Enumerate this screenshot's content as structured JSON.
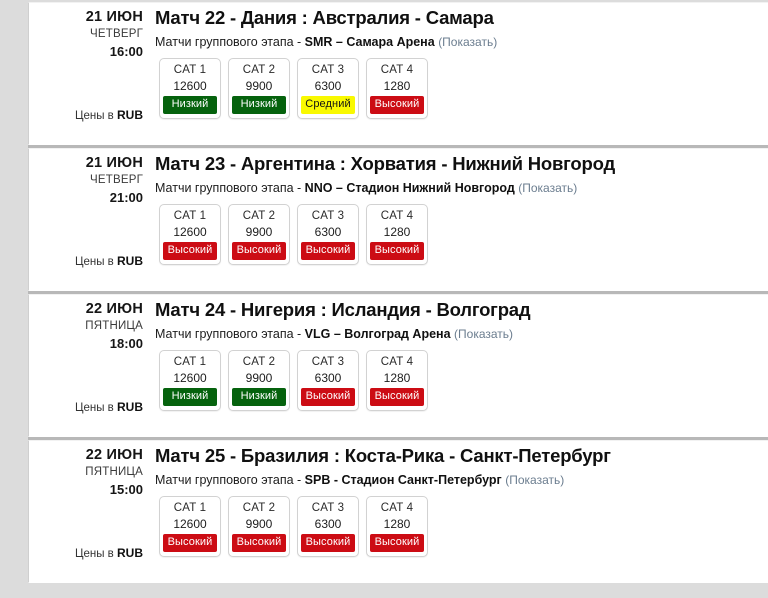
{
  "currency_note_prefix": "Цены в ",
  "currency_code": "RUB",
  "show_link_label": "(Показать)",
  "subtitle_prefix": "Матчи группового этапа - ",
  "badge_colors": {
    "low": "#05620d",
    "medium": "#f9f900",
    "high": "#cc0c14"
  },
  "matches": [
    {
      "date_day": "21 ИЮН",
      "date_weekday": "ЧЕТВЕРГ",
      "date_time": "16:00",
      "title": "Матч 22 - Дания : Австралия - Самара",
      "subtitle_prefix": "Матчи группового этапа - ",
      "venue": "SMR – Самара Арена",
      "show_link_label": "(Показать)",
      "currency_note_prefix": "Цены в ",
      "currency_code": "RUB",
      "categories": [
        {
          "name": "CAT 1",
          "price": "12600",
          "badge": "Низкий",
          "level": "low"
        },
        {
          "name": "CAT 2",
          "price": "9900",
          "badge": "Низкий",
          "level": "low"
        },
        {
          "name": "CAT 3",
          "price": "6300",
          "badge": "Средний",
          "level": "medium"
        },
        {
          "name": "CAT 4",
          "price": "1280",
          "badge": "Высокий",
          "level": "high"
        }
      ]
    },
    {
      "date_day": "21 ИЮН",
      "date_weekday": "ЧЕТВЕРГ",
      "date_time": "21:00",
      "title": "Матч 23 - Аргентина : Хорватия - Нижний Новгород",
      "subtitle_prefix": "Матчи группового этапа - ",
      "venue": "NNO – Стадион Нижний Новгород",
      "show_link_label": "(Показать)",
      "currency_note_prefix": "Цены в ",
      "currency_code": "RUB",
      "categories": [
        {
          "name": "CAT 1",
          "price": "12600",
          "badge": "Высокий",
          "level": "high"
        },
        {
          "name": "CAT 2",
          "price": "9900",
          "badge": "Высокий",
          "level": "high"
        },
        {
          "name": "CAT 3",
          "price": "6300",
          "badge": "Высокий",
          "level": "high"
        },
        {
          "name": "CAT 4",
          "price": "1280",
          "badge": "Высокий",
          "level": "high"
        }
      ]
    },
    {
      "date_day": "22 ИЮН",
      "date_weekday": "ПЯТНИЦА",
      "date_time": "18:00",
      "title": "Матч 24 - Нигерия : Исландия - Волгоград",
      "subtitle_prefix": "Матчи группового этапа - ",
      "venue": "VLG – Волгоград Арена",
      "show_link_label": "(Показать)",
      "currency_note_prefix": "Цены в ",
      "currency_code": "RUB",
      "categories": [
        {
          "name": "CAT 1",
          "price": "12600",
          "badge": "Низкий",
          "level": "low"
        },
        {
          "name": "CAT 2",
          "price": "9900",
          "badge": "Низкий",
          "level": "low"
        },
        {
          "name": "CAT 3",
          "price": "6300",
          "badge": "Высокий",
          "level": "high"
        },
        {
          "name": "CAT 4",
          "price": "1280",
          "badge": "Высокий",
          "level": "high"
        }
      ]
    },
    {
      "date_day": "22 ИЮН",
      "date_weekday": "ПЯТНИЦА",
      "date_time": "15:00",
      "title": "Матч 25 - Бразилия : Коста-Рика - Санкт-Петербург",
      "subtitle_prefix": "Матчи группового этапа - ",
      "venue": "SPB - Стадион Санкт-Петербург",
      "show_link_label": "(Показать)",
      "currency_note_prefix": "Цены в ",
      "currency_code": "RUB",
      "categories": [
        {
          "name": "CAT 1",
          "price": "12600",
          "badge": "Высокий",
          "level": "high"
        },
        {
          "name": "CAT 2",
          "price": "9900",
          "badge": "Высокий",
          "level": "high"
        },
        {
          "name": "CAT 3",
          "price": "6300",
          "badge": "Высокий",
          "level": "high"
        },
        {
          "name": "CAT 4",
          "price": "1280",
          "badge": "Высокий",
          "level": "high"
        }
      ]
    }
  ]
}
